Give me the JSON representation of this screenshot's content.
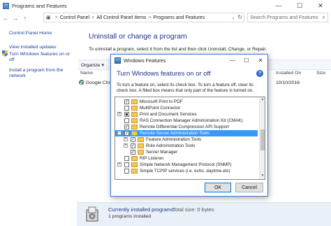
{
  "window": {
    "title": "Programs and Features",
    "minimize": "—",
    "maximize": "☐",
    "close": "✕"
  },
  "address": {
    "crumbs": [
      "Control Panel",
      "All Control Panel Items",
      "Programs and Features"
    ],
    "separator": ">",
    "search_placeholder": "Search Programs and Features"
  },
  "sidebar": {
    "items": [
      {
        "label": "Control Panel Home"
      },
      {
        "label": "View installed updates"
      },
      {
        "label": "Turn Windows features on or off"
      },
      {
        "label": "Install a program from the network"
      }
    ]
  },
  "main": {
    "heading": "Uninstall or change a program",
    "description": "To uninstall a program, select it from the list and then click Uninstall, Change, or Repair.",
    "organize_label": "Organize ▾",
    "columns": {
      "name": "Name",
      "installed_on": "Installed On",
      "size": "Size"
    },
    "rows": [
      {
        "name": "Google Chrome",
        "installed_on": "10/10/2016"
      }
    ]
  },
  "status": {
    "title": "Currently installed programs",
    "total_size": "Total size: 0 bytes",
    "count": "1 programs installed"
  },
  "dialog": {
    "title": "Windows Features",
    "heading": "Turn Windows features on or off",
    "help": "?",
    "description": "To turn a feature on, select its check box. To turn a feature off, clear its check box. A filled box means that only part of the feature is turned on.",
    "features": [
      {
        "label": "Microsoft Print to PDF",
        "state": "checked"
      },
      {
        "label": "MultiPoint Connector",
        "state": "unchecked"
      },
      {
        "label": "Print and Document Services",
        "state": "partial",
        "expandable": true
      },
      {
        "label": "RAS Connection Manager Administration Kit (CMAK)",
        "state": "unchecked"
      },
      {
        "label": "Remote Differential Compression API Support",
        "state": "checked"
      },
      {
        "label": "Remote Server Administration Tools",
        "state": "checked",
        "expandable": true,
        "expanded": true,
        "selected": true
      },
      {
        "label": "Feature Administration Tools",
        "state": "checked",
        "expandable": true,
        "level": 1
      },
      {
        "label": "Role Administration Tools",
        "state": "checked",
        "expandable": true,
        "level": 1
      },
      {
        "label": "Server Manager",
        "state": "checked",
        "level": 1
      },
      {
        "label": "RIP Listener",
        "state": "unchecked"
      },
      {
        "label": "Simple Network Management Protocol (SNMP)",
        "state": "unchecked",
        "expandable": true
      },
      {
        "label": "Simple TCPIP services (i.e. echo, daytime etc)",
        "state": "unchecked"
      }
    ],
    "ok": "OK",
    "cancel": "Cancel"
  },
  "colors": {
    "link": "#1a3e9c",
    "heading": "#1e3287",
    "selection": "#3399ff",
    "statusbar": "#e9f0f8"
  }
}
